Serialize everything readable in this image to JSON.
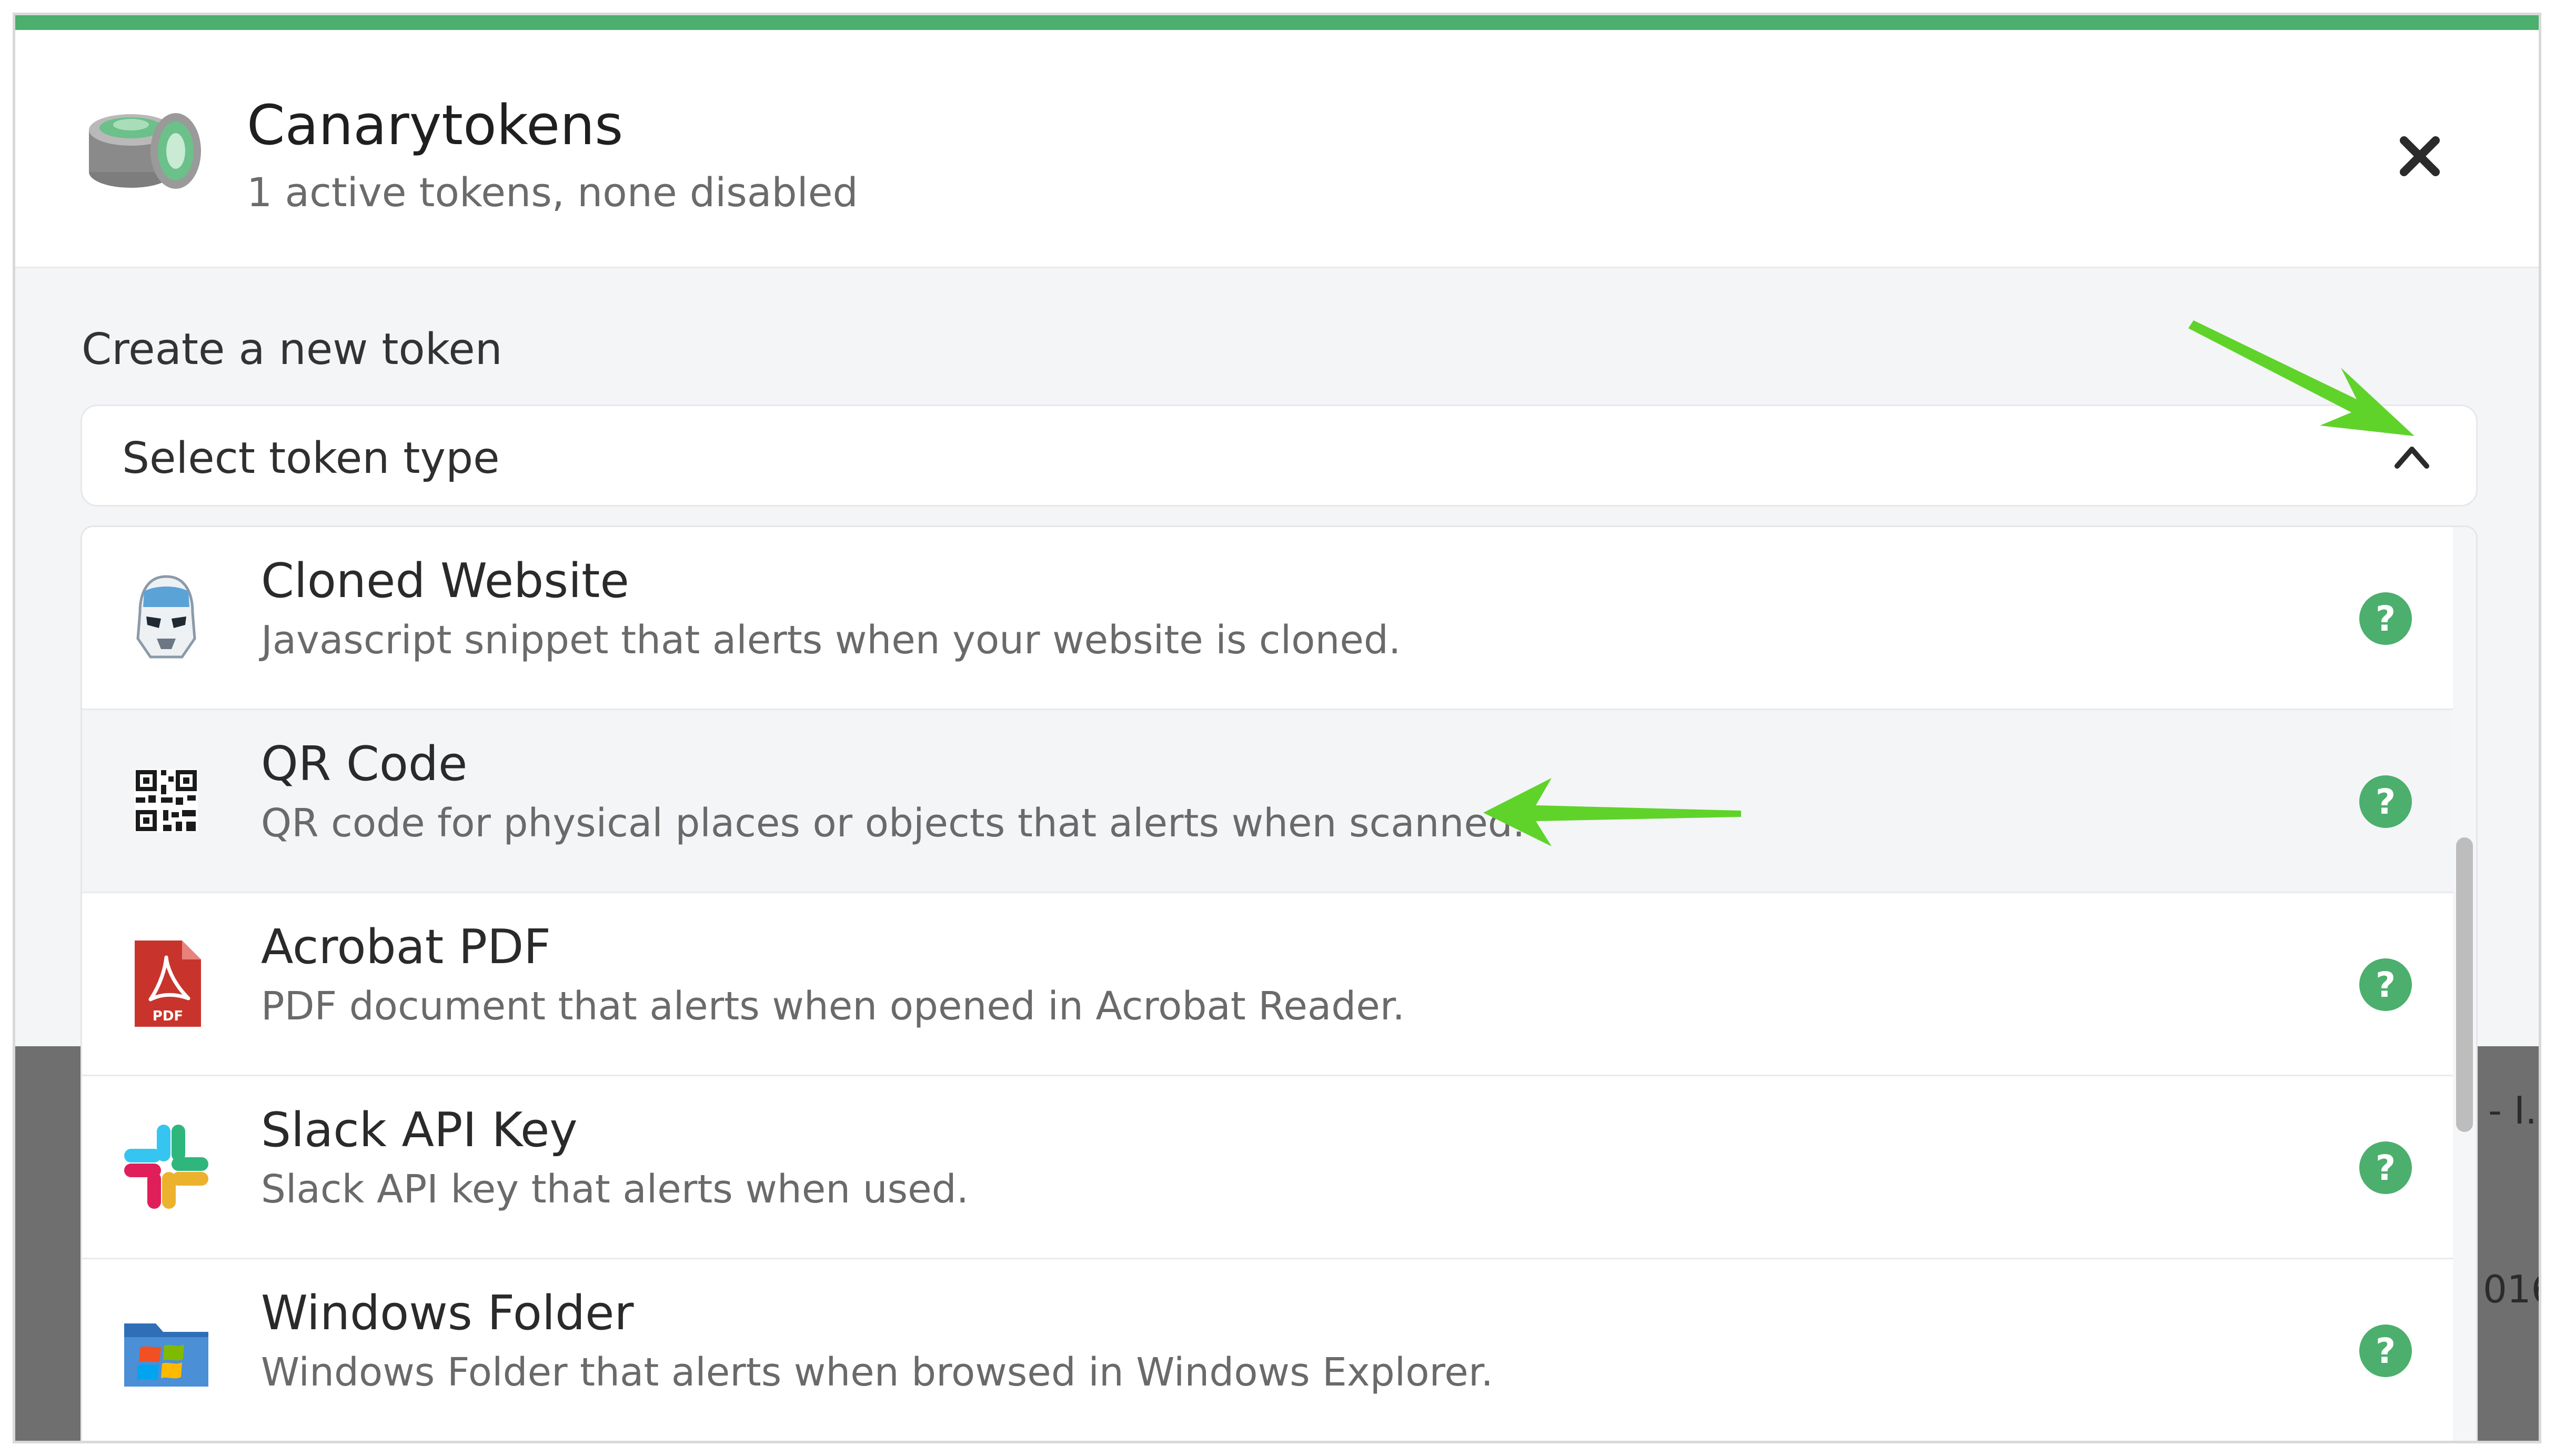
{
  "app": {
    "title": "Canarytokens",
    "subtitle": "1 active tokens, none disabled",
    "icon": "canary-coins-icon",
    "close_icon": "close-icon",
    "accent_color": "#4caf6d"
  },
  "create": {
    "label": "Create a new token",
    "select_label": "Select token type",
    "chevron_icon": "chevron-up-icon"
  },
  "token_types": [
    {
      "title": "Cloned Website",
      "description": "Javascript snippet that alerts when your website is cloned.",
      "icon": "stormtrooper-icon"
    },
    {
      "title": "QR Code",
      "description": "QR code for physical places or objects that alerts when scanned.",
      "icon": "qr-code-icon"
    },
    {
      "title": "Acrobat PDF",
      "description": "PDF document that alerts when opened in Acrobat Reader.",
      "icon": "pdf-icon",
      "icon_text": "PDF"
    },
    {
      "title": "Slack API Key",
      "description": "Slack API key that alerts when used.",
      "icon": "slack-icon"
    },
    {
      "title": "Windows Folder",
      "description": "Windows Folder that alerts when browsed in Windows Explorer.",
      "icon": "windows-folder-icon"
    }
  ],
  "help_glyph": "?",
  "background_fragments": [
    "- I.",
    "016"
  ]
}
